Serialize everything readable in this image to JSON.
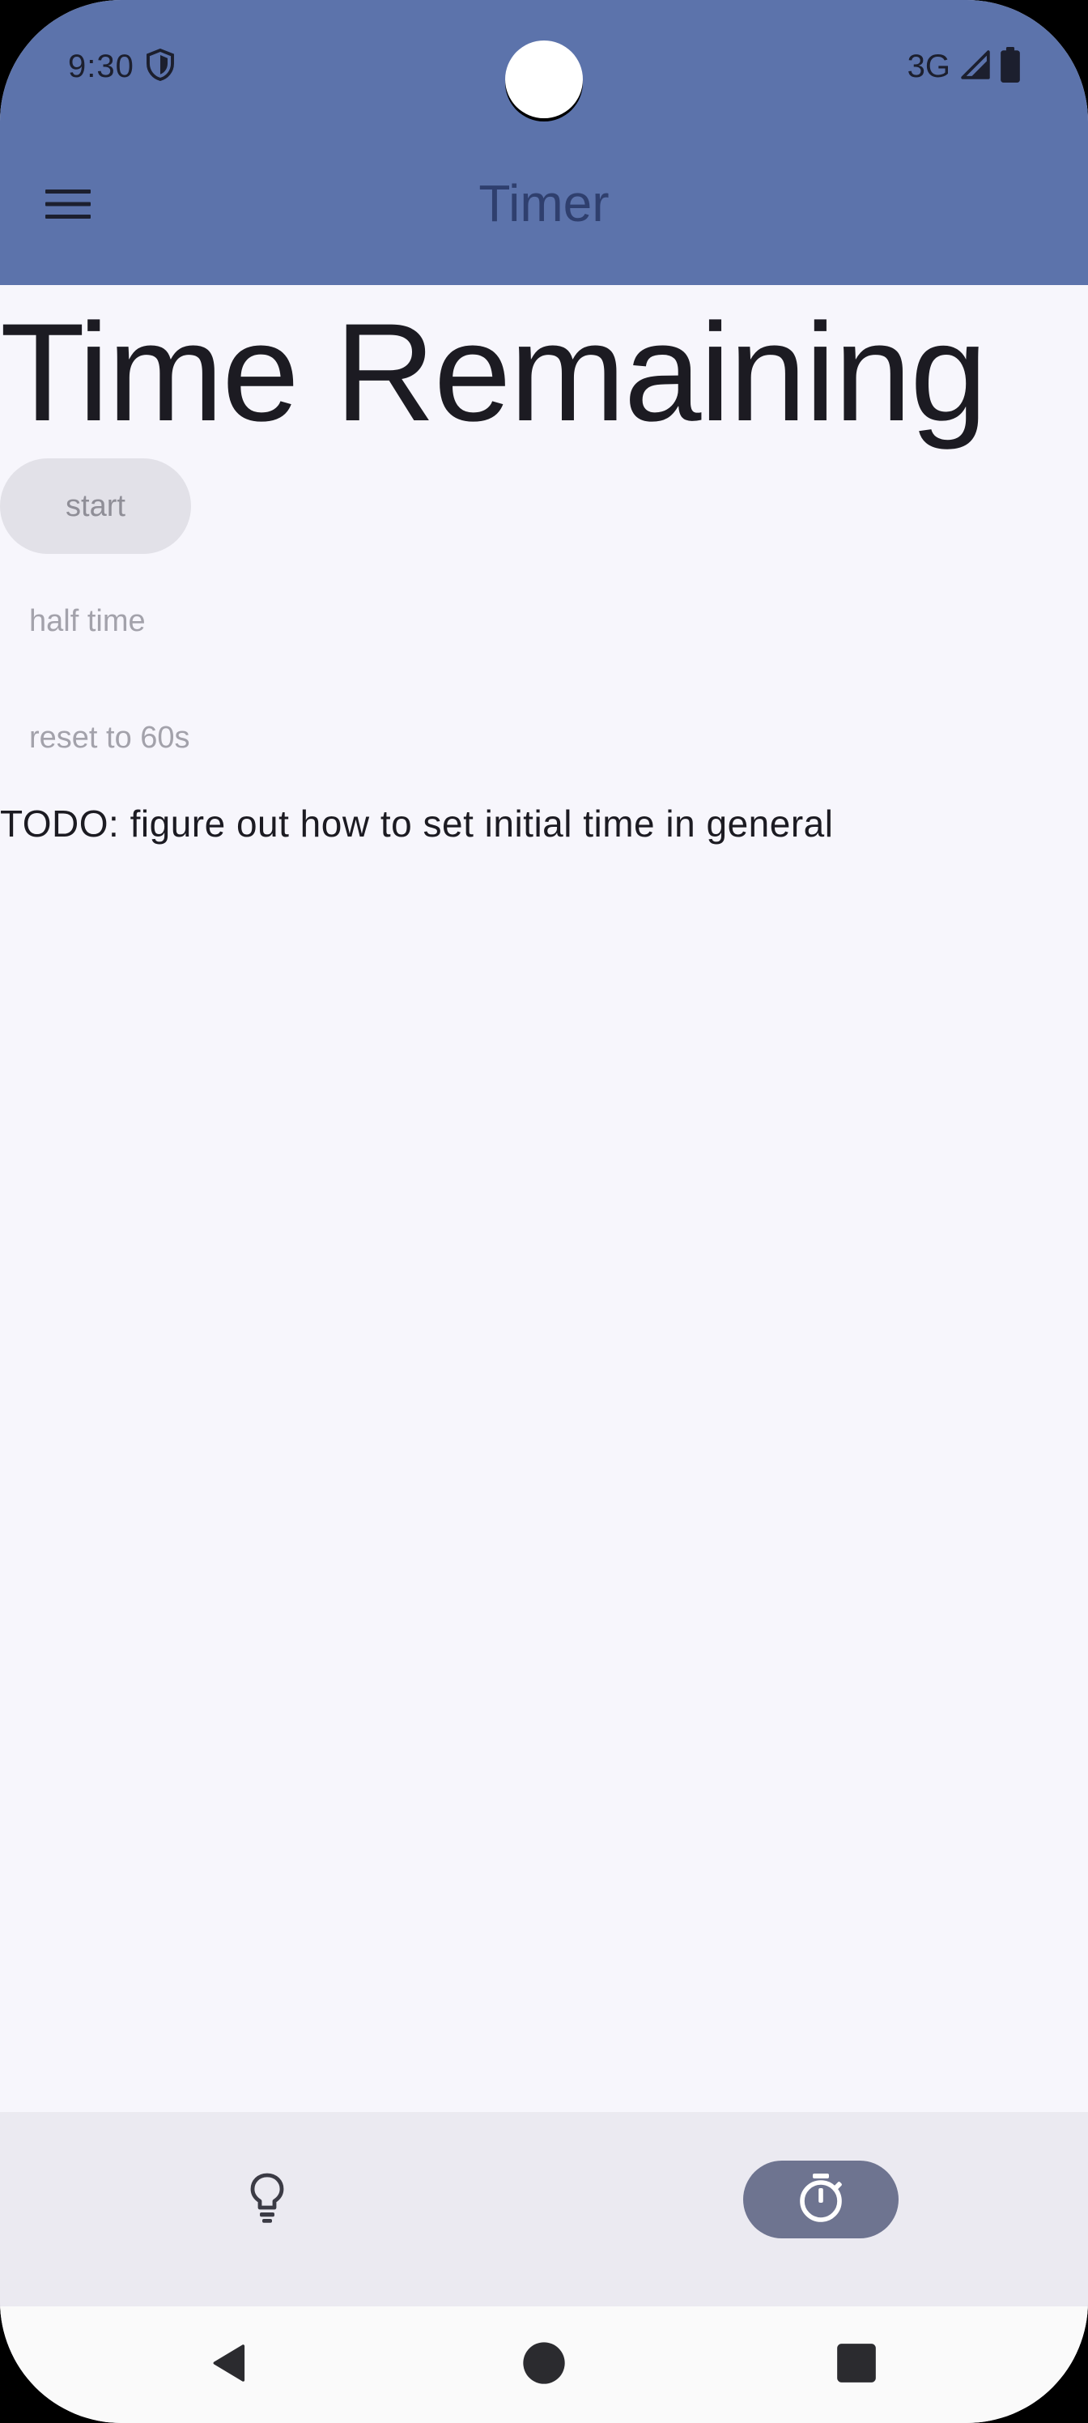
{
  "status_bar": {
    "time": "9:30",
    "network": "3G",
    "icons": [
      "shield-icon",
      "signal-icon",
      "battery-icon"
    ]
  },
  "app_bar": {
    "title": "Timer",
    "menu_icon": "hamburger-menu-icon"
  },
  "main": {
    "heading": "Time Remaining",
    "start_label": "start",
    "half_time_label": "half time",
    "reset_label": "reset to 60s",
    "todo_text": "TODO: figure out how to set initial time in general"
  },
  "bottom_nav": {
    "items": [
      {
        "icon": "lightbulb-icon",
        "selected": false
      },
      {
        "icon": "stopwatch-icon",
        "selected": true
      }
    ]
  },
  "system_nav": {
    "buttons": [
      "back-icon",
      "home-icon",
      "recents-icon"
    ]
  },
  "colors": {
    "app_bar": "#5c73ab",
    "title_text": "#2f3f6e",
    "background": "#f7f6fc",
    "bottom_nav": "#ebeaf1",
    "nav_indicator": "#6e7490"
  }
}
